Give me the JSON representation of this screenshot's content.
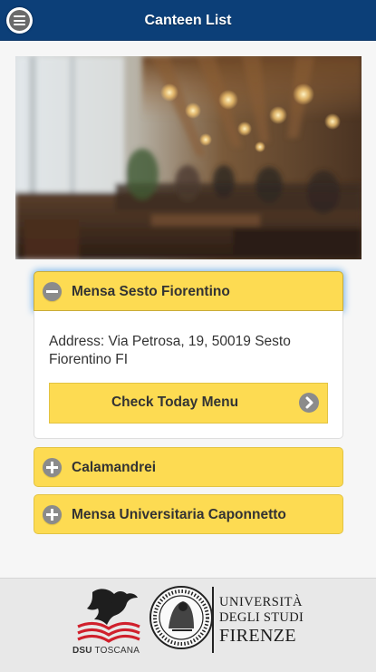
{
  "header": {
    "title": "Canteen List"
  },
  "canteens": [
    {
      "name": "Mensa Sesto Fiorentino",
      "expanded": true,
      "address": "Address: Via Petrosa, 19, 50019 Sesto Fiorentino FI",
      "menu_button": "Check Today Menu"
    },
    {
      "name": "Calamandrei",
      "expanded": false
    },
    {
      "name": "Mensa Universitaria Caponnetto",
      "expanded": false
    }
  ],
  "footer": {
    "dsu_logo": {
      "text_bold": "DSU",
      "text_rest": " TOSCANA"
    },
    "unifi_logo": {
      "line1": "UNIVERSITÀ",
      "line2": "DEGLI STUDI",
      "line3": "FIRENZE"
    }
  },
  "colors": {
    "header": "#0c3f78",
    "accent": "#fddb52",
    "icon": "#8b8b8b"
  }
}
